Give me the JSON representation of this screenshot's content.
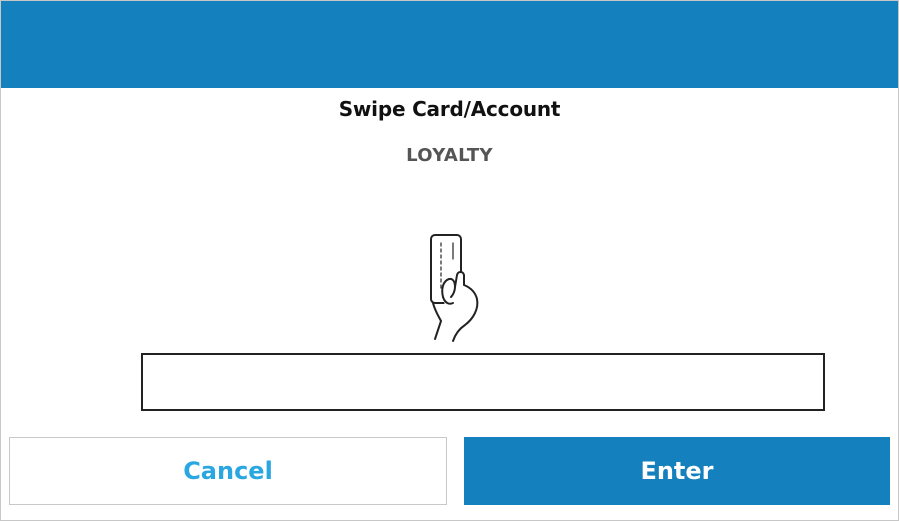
{
  "dialog": {
    "title": "Swipe Card/Account",
    "subtitle": "LOYALTY"
  },
  "account_input": {
    "value": "",
    "placeholder": ""
  },
  "buttons": {
    "cancel_label": "Cancel",
    "enter_label": "Enter"
  },
  "icons": {
    "card_swipe": "card-swipe-hand-icon"
  },
  "colors": {
    "header": "#1480bd",
    "enter_button": "#1480bd",
    "cancel_text": "#2aa7e0",
    "title_text": "#111111",
    "subtitle_text": "#555555"
  }
}
